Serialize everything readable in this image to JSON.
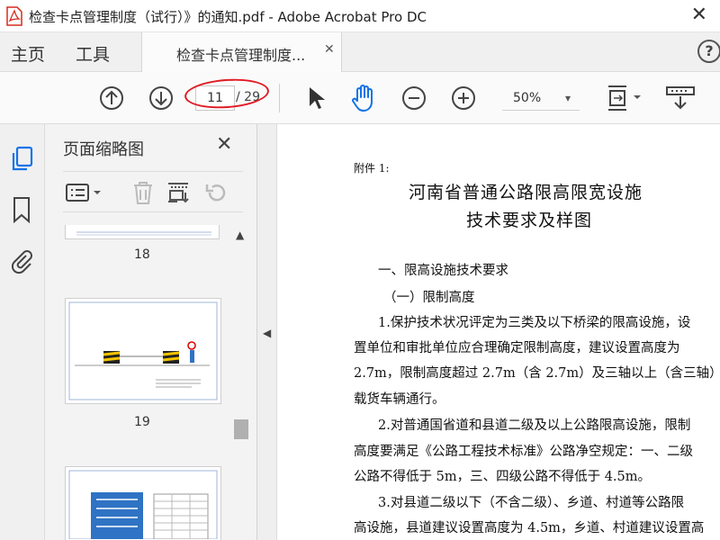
{
  "window": {
    "title": "检查卡点管理制度（试行）》的通知.pdf - Adobe Acrobat Pro DC",
    "close_glyph": "✕"
  },
  "tabs": {
    "home": "主页",
    "tools": "工具",
    "document": "检查卡点管理制度...",
    "document_close": "✕",
    "help": "?"
  },
  "toolbar": {
    "current_page": "11",
    "page_total": "/ 29",
    "zoom": "50%",
    "zoom_caret": "▾"
  },
  "sidebar": {
    "icons": [
      "pages-icon",
      "bookmark-icon",
      "attachment-icon"
    ]
  },
  "thumbnails": {
    "title": "页面缩略图",
    "close": "✕",
    "pages": [
      {
        "number": "18"
      },
      {
        "number": "19"
      },
      {
        "number": ""
      }
    ]
  },
  "document": {
    "attachment_label": "附件 1:",
    "title_line1": "河南省普通公路限高限宽设施",
    "title_line2": "技术要求及样图",
    "section1": "一、限高设施技术要求",
    "subsection1": "（一）限制高度",
    "para1": [
      "1.保护技术状况评定为三类及以下桥梁的限高设施，设",
      "置单位和审批单位应合理确定限制高度，建议设置高度为",
      "2.7m，限制高度超过 2.7m（含 2.7m）及三轴以上（含三轴）",
      "载货车辆通行。"
    ],
    "para2": [
      "2.对普通国省道和县道二级及以上公路限高设施，限制",
      "高度要满足《公路工程技术标准》公路净空规定：一、二级",
      "公路不得低于 5m，三、四级公路不得低于 4.5m。"
    ],
    "para3": [
      "3.对县道二级以下（不含二级）、乡道、村道等公路限",
      "高设施，县道建议设置高度为 4.5m，乡道、村道建议设置高"
    ]
  },
  "colors": {
    "annotation_red": "#e01b24",
    "acrobat_red": "#d52b1e",
    "active_blue": "#1473e6",
    "thumb_blue": "#2f73c4"
  }
}
